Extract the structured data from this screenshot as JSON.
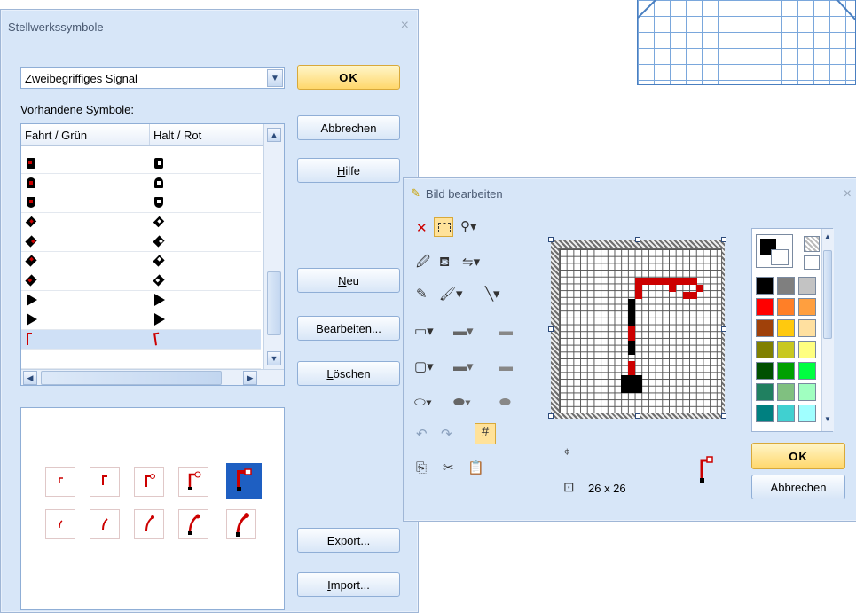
{
  "main_dialog": {
    "title": "Stellwerkssymbole",
    "close": "×",
    "type_select": "Zweibegriffiges Signal",
    "available_label": "Vorhandene Symbole:",
    "columns": [
      "Fahrt / Grün",
      "Halt / Rot"
    ],
    "buttons": {
      "ok": "OK",
      "cancel": "Abbrechen",
      "help_pre": "",
      "help_u": "H",
      "help_post": "ilfe",
      "new_pre": "",
      "new_u": "N",
      "new_post": "eu",
      "edit_pre": "",
      "edit_u": "B",
      "edit_post": "earbeiten...",
      "delete_pre": "",
      "delete_u": "L",
      "delete_post": "öschen",
      "export_pre": "E",
      "export_u": "x",
      "export_post": "port...",
      "import_pre": "",
      "import_u": "I",
      "import_post": "mport..."
    }
  },
  "editor": {
    "title": "Bild bearbeiten",
    "close": "×",
    "size_text": "26 x 26",
    "buttons": {
      "ok": "OK",
      "cancel": "Abbrechen"
    },
    "colors": {
      "accent_red": "#cc0000",
      "palette": [
        "#000000",
        "#7f7f7f",
        "#c3c3c3",
        "#ff0000",
        "#ff7f27",
        "#ff9f3f",
        "#a0410a",
        "#ffc90e",
        "#ffe0a0",
        "#808000",
        "#c8c820",
        "#ffff80",
        "#005000",
        "#00a000",
        "#00ff40",
        "#208060",
        "#80c080",
        "#a0ffc0",
        "#008080",
        "#40d0d0",
        "#a0ffff"
      ]
    }
  }
}
